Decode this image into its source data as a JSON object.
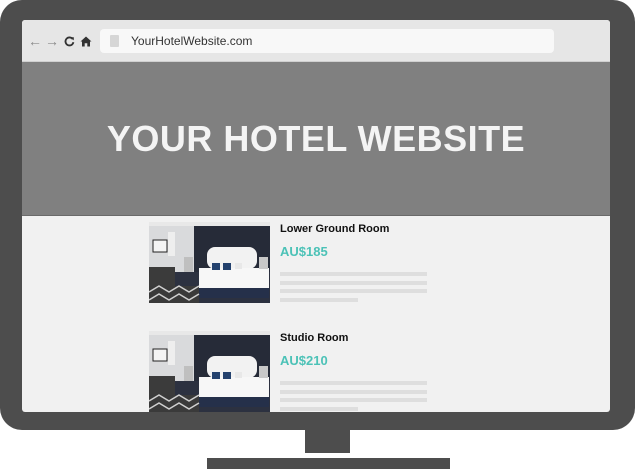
{
  "browser": {
    "url": "YourHotelWebsite.com",
    "icons": {
      "back": "arrow-left-icon",
      "forward": "arrow-right-icon",
      "reload": "reload-icon",
      "home": "home-icon",
      "page": "page-icon"
    }
  },
  "hero": {
    "title": "YOUR HOTEL WEBSITE"
  },
  "rooms": [
    {
      "name": "Lower Ground Room",
      "price": "AU$185"
    },
    {
      "name": "Studio Room",
      "price": "AU$210"
    }
  ],
  "colors": {
    "monitor_frame": "#4d4d4d",
    "hero_background": "#808080",
    "price_accent": "#4cc2b7",
    "page_background": "#f1f1f1"
  }
}
